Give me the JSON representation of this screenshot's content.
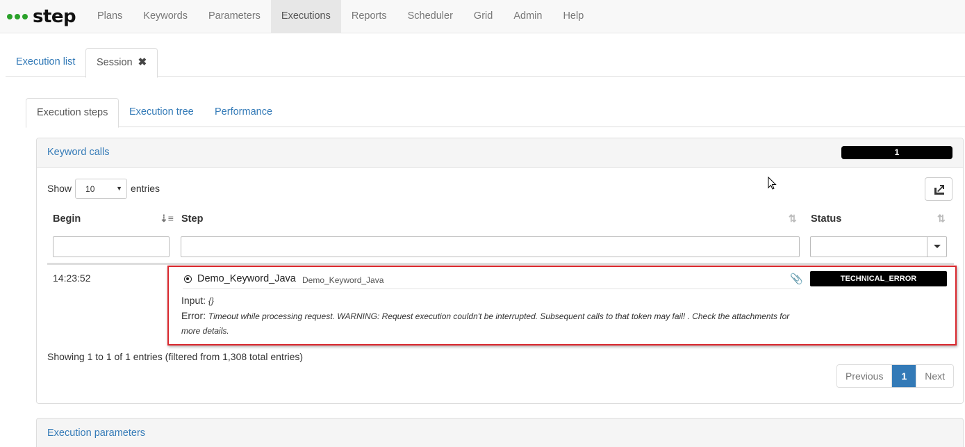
{
  "app": {
    "logo_text": "step"
  },
  "nav": {
    "items": [
      {
        "label": "Plans"
      },
      {
        "label": "Keywords"
      },
      {
        "label": "Parameters"
      },
      {
        "label": "Executions",
        "active": true
      },
      {
        "label": "Reports"
      },
      {
        "label": "Scheduler"
      },
      {
        "label": "Grid"
      },
      {
        "label": "Admin"
      },
      {
        "label": "Help"
      }
    ]
  },
  "outer_tabs": {
    "execution_list": "Execution list",
    "session": "Session",
    "session_close": "✖"
  },
  "inner_tabs": {
    "steps": "Execution steps",
    "tree": "Execution tree",
    "performance": "Performance"
  },
  "keyword_calls": {
    "title": "Keyword calls",
    "count": "1",
    "show_label": "Show",
    "entries_label": "entries",
    "page_length": "10",
    "columns": {
      "begin": "Begin",
      "step": "Step",
      "status": "Status"
    },
    "rows": [
      {
        "time": "14:23:52",
        "step_name": "Demo_Keyword_Java",
        "step_sub": "Demo_Keyword_Java",
        "input_label": "Input:",
        "input_value": "{}",
        "error_label": "Error:",
        "error_text": "Timeout while processing request. WARNING: Request execution couldn't be interrupted. Subsequent calls to that token may fail! . Check the attachments for more details.",
        "status": "TECHNICAL_ERROR"
      }
    ],
    "info": "Showing 1 to 1 of 1 entries (filtered from 1,308 total entries)",
    "pager": {
      "previous": "Previous",
      "current": "1",
      "next": "Next"
    }
  },
  "execution_parameters": {
    "title": "Execution parameters"
  },
  "colors": {
    "accent": "#337ab7",
    "logo_dots": "#2aa12a",
    "highlight_border": "#d9262c"
  }
}
